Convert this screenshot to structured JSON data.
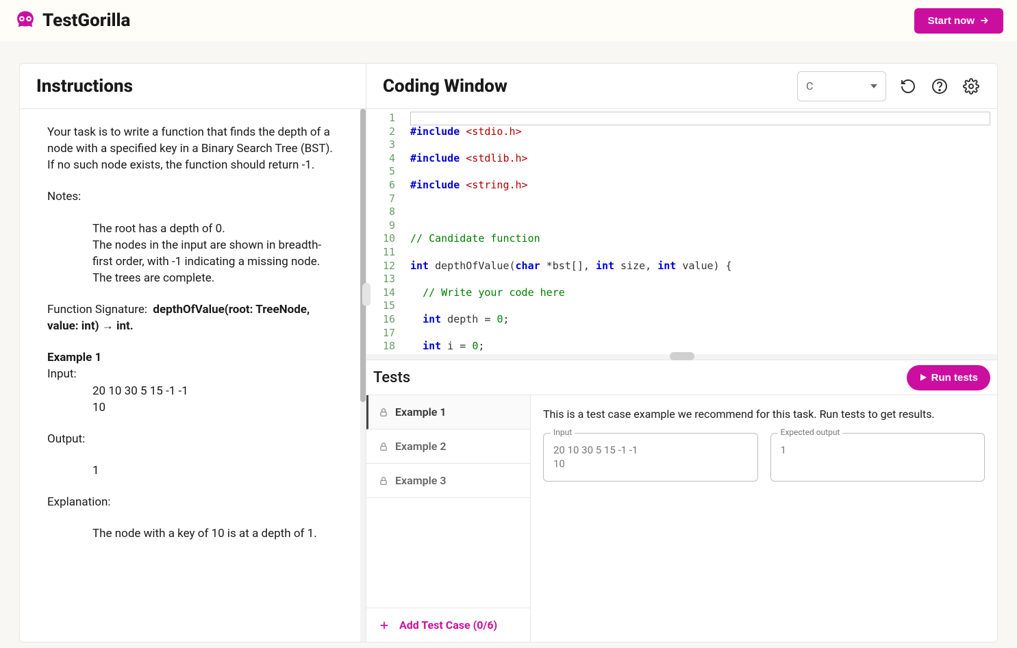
{
  "header": {
    "brand": "TestGorilla",
    "start_label": "Start now"
  },
  "instructions": {
    "title": "Instructions",
    "intro": "Your task is to write a function that finds the depth of a node with a specified key in a Binary Search Tree (BST). If no such node exists, the function should return -1.",
    "notes_label": "Notes:",
    "notes": {
      "n0": "The root has a depth of 0.",
      "n1": "The nodes in the input are shown in breadth-first order, with -1 indicating a missing node.",
      "n2": "The trees are complete."
    },
    "sig_label": "Function Signature:",
    "sig": "depthOfValue(root: TreeNode, value: int) → int.",
    "example1_label": "Example 1",
    "input_label": "Input:",
    "example1_input_l1": "20 10 30 5 15 -1 -1",
    "example1_input_l2": "10",
    "output_label": "Output:",
    "example1_output": "1",
    "explanation_label": "Explanation:",
    "example1_explanation": "The node with a key of 10 is at a depth of 1."
  },
  "coding": {
    "title": "Coding Window",
    "language": "C",
    "lines": {
      "l1a": "#include ",
      "l1b": "<stdio.h>",
      "l2a": "#include ",
      "l2b": "<stdlib.h>",
      "l3a": "#include ",
      "l3b": "<string.h>",
      "l5": "// Candidate function",
      "l7": "// Write your code here"
    }
  },
  "tests": {
    "title": "Tests",
    "run_label": "Run tests",
    "items": {
      "i0": "Example 1",
      "i1": "Example 2",
      "i2": "Example 3"
    },
    "add_label": "Add Test Case (0/6)",
    "desc": "This is a test case example we recommend for this task. Run tests to get results.",
    "input_legend": "Input",
    "output_legend": "Expected output",
    "input_value": "20 10 30 5 15 -1 -1\n10",
    "output_value": "1"
  }
}
